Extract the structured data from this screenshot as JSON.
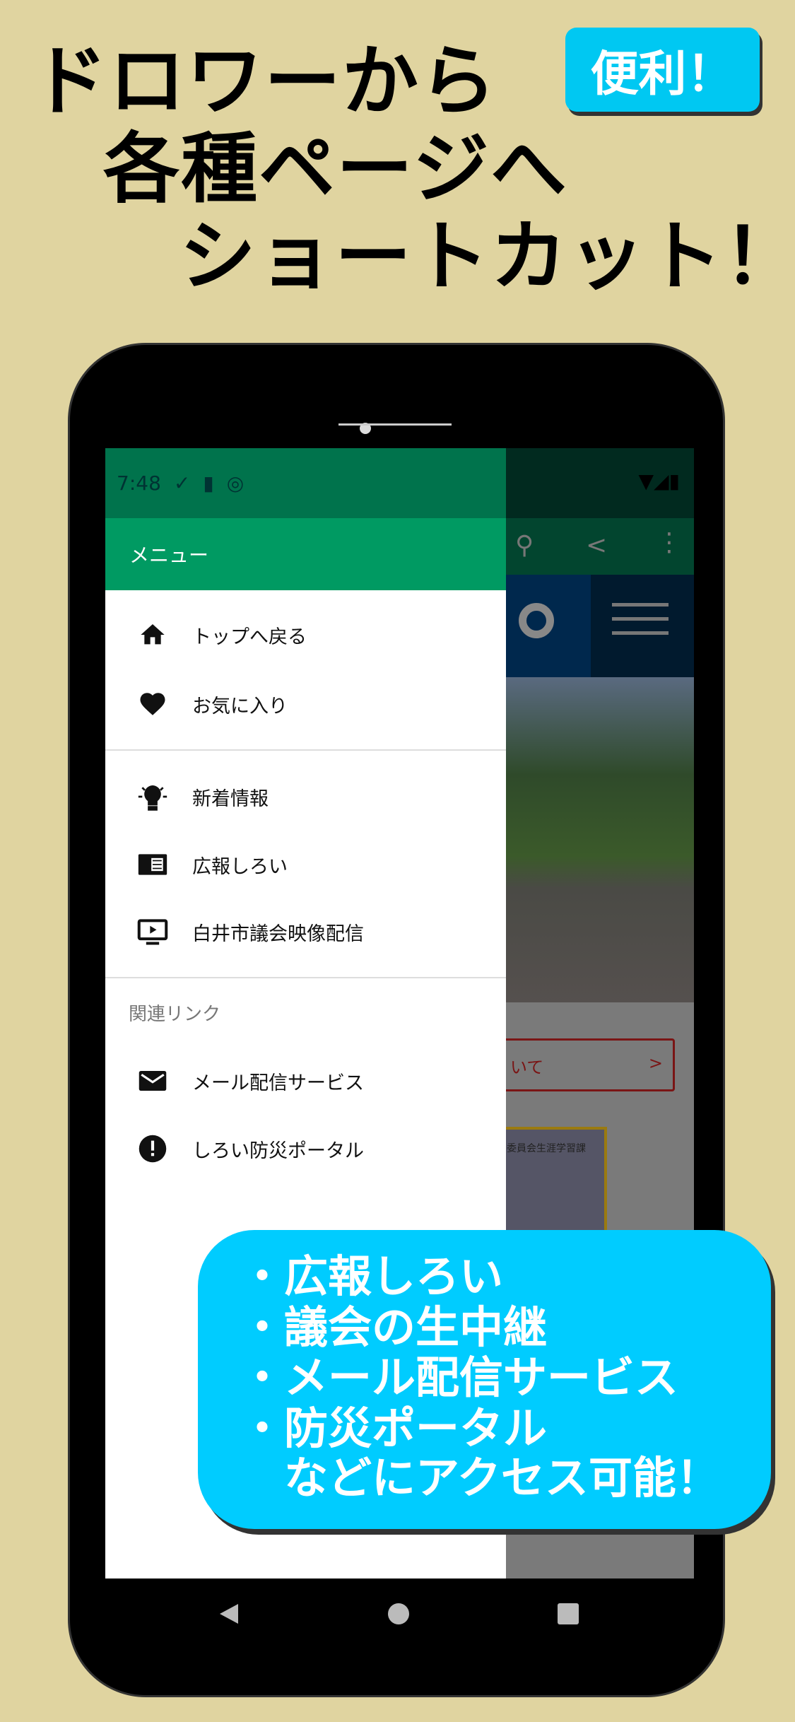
{
  "headline": {
    "line1": "ドロワーから",
    "line2": "各種ページへ",
    "line3": "ショートカット！"
  },
  "badge": "便利！",
  "status_bar": {
    "time": "7:48"
  },
  "drawer": {
    "title": "メニュー",
    "items": [
      {
        "label": "トップへ戻る",
        "icon": "home-icon"
      },
      {
        "label": "お気に入り",
        "icon": "heart-icon"
      },
      {
        "label": "新着情報",
        "icon": "lightbulb-icon"
      },
      {
        "label": "広報しろい",
        "icon": "newspaper-icon"
      },
      {
        "label": "白井市議会映像配信",
        "icon": "tv-play-icon"
      },
      {
        "label": "メール配信サービス",
        "icon": "mail-icon"
      },
      {
        "label": "しろい防災ポータル",
        "icon": "alert-icon"
      }
    ],
    "section_label": "関連リンク"
  },
  "background_page": {
    "link_text": "いて",
    "link_arrow": ">",
    "thumb_text": "委員会生涯学習課"
  },
  "bubble": {
    "lines": [
      "・広報しろい",
      "・議会の生中継",
      "・メール配信サービス",
      "・防災ポータル",
      "　などにアクセス可能！"
    ]
  },
  "colors": {
    "background": "#e0d4a0",
    "accent": "#00ccff",
    "drawer_header": "#009a62",
    "status_bar": "#00734c"
  }
}
